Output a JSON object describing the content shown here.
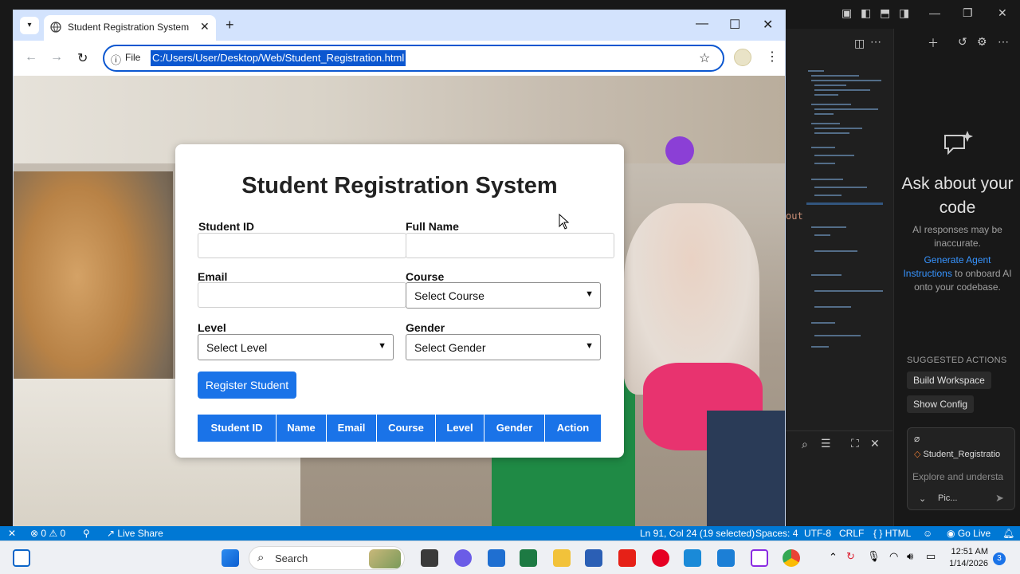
{
  "browser": {
    "tab_title": "Student Registration System",
    "new_tab": "+",
    "omnibox_scheme": "File",
    "url": "C:/Users/User/Desktop/Web/Student_Registration.html"
  },
  "page": {
    "title": "Student Registration System",
    "labels": {
      "student_id": "Student ID",
      "full_name": "Full Name",
      "email": "Email",
      "course": "Course",
      "level": "Level",
      "gender": "Gender"
    },
    "inputs": {
      "student_id": "",
      "full_name": "",
      "email": ""
    },
    "selects": {
      "course": "Select Course",
      "level": "Select Level",
      "gender": "Select Gender"
    },
    "register_button": "Register Student",
    "table_headers": [
      "Student ID",
      "Name",
      "Email",
      "Course",
      "Level",
      "Gender",
      "Action"
    ]
  },
  "vscode": {
    "chat": {
      "heading": "Ask about your code",
      "disclaimer": "AI responses may be inaccurate.",
      "link": "Generate Agent Instructions",
      "link_suffix": "to onboard AI onto your codebase.",
      "suggested_heading": "SUGGESTED ACTIONS",
      "actions": [
        "Build Workspace",
        "Show Config"
      ],
      "attached_file": "Student_Registratio",
      "input_placeholder": "Explore and understa",
      "model_label": "Pic..."
    },
    "editor_fragment": "out",
    "status": {
      "errors": "0",
      "warnings": "0",
      "live_share": "Live Share",
      "cursor": "Ln 91, Col 24 (19 selected)",
      "spaces": "Spaces: 4",
      "encoding": "UTF-8",
      "eol": "CRLF",
      "language": "HTML",
      "go_live": "Go Live"
    }
  },
  "taskbar": {
    "search_label": "Search",
    "time": "12:51 AM",
    "date": "1/14/2026",
    "badge": "3"
  },
  "colors": {
    "accent": "#1a73e8",
    "vscode_status": "#0078d4",
    "chrome_tabstrip": "#d3e3fd"
  }
}
